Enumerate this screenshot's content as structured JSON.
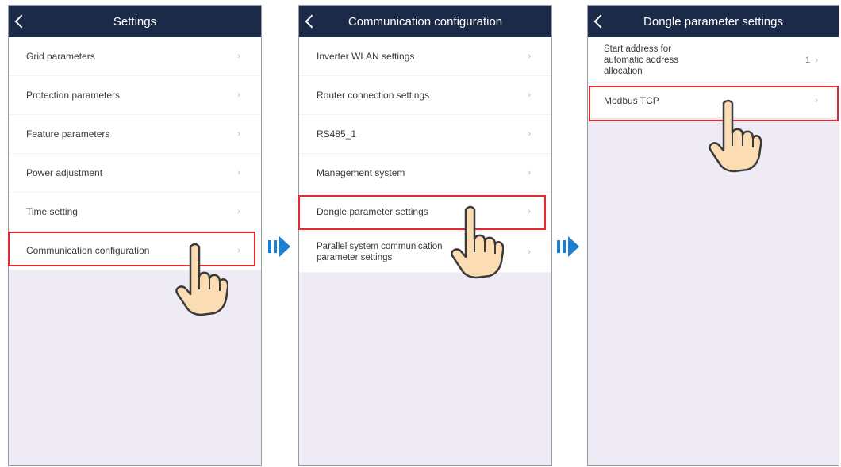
{
  "panels": [
    {
      "title": "Settings",
      "items": [
        {
          "label": "Grid parameters",
          "chevron": "›"
        },
        {
          "label": "Protection parameters",
          "chevron": "›"
        },
        {
          "label": "Feature parameters",
          "chevron": "›"
        },
        {
          "label": "Power adjustment",
          "chevron": "›"
        },
        {
          "label": "Time setting",
          "chevron": "›"
        },
        {
          "label": "Communication configuration",
          "chevron": "›"
        }
      ]
    },
    {
      "title": "Communication configuration",
      "items": [
        {
          "label": "Inverter WLAN settings",
          "chevron": "›"
        },
        {
          "label": "Router connection settings",
          "chevron": "›"
        },
        {
          "label": "RS485_1",
          "chevron": "›"
        },
        {
          "label": "Management system",
          "chevron": "›"
        },
        {
          "label": "Dongle parameter settings",
          "chevron": "›"
        },
        {
          "label": "Parallel system communication parameter settings",
          "chevron": "›"
        }
      ]
    },
    {
      "title": "Dongle parameter settings",
      "items": [
        {
          "label": "Start address for automatic address allocation",
          "value": "1",
          "chevron": "›"
        },
        {
          "label": "Modbus TCP",
          "chevron": "›"
        }
      ]
    }
  ],
  "colors": {
    "header_bg": "#1a2a48",
    "panel_bg": "#eeebf5",
    "highlight": "#e5282f",
    "arrow": "#1e7fd0"
  },
  "icons": [
    "back-icon",
    "chevron-right-icon",
    "pointing-hand-icon",
    "double-arrow-right-icon"
  ]
}
